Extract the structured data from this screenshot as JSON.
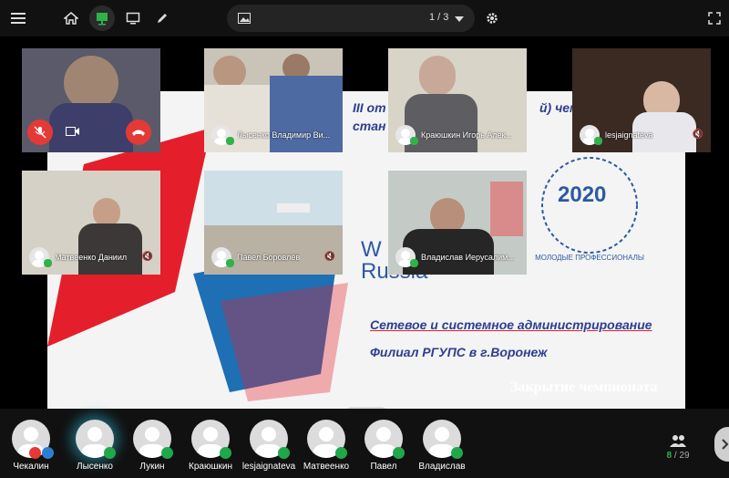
{
  "toolbar": {
    "slide_counter": "1 / 3"
  },
  "slide": {
    "caption": "Закрытие чемпионата",
    "line1": "Сетевое и системное администрирование",
    "line2": "Филиал РГУПС в г.Воронеж",
    "partial_top": "III от",
    "partial_top2": "й) чем",
    "partial_top3": "стан",
    "partial_logo": "W",
    "partial_logo2": "Russia",
    "badge_text": "МОЛОДЫЕ ПРОФЕССИОНАЛЫ",
    "badge_year": "2020"
  },
  "tiles": [
    {
      "name": "",
      "self": true
    },
    {
      "name": "Лысенко Владимир Ви..."
    },
    {
      "name": "Краюшкин Игорь Алек..."
    },
    {
      "name": "lesjaignateva"
    },
    {
      "name": "Матвеенко Даниил"
    },
    {
      "name": "Павел Боровлёв"
    },
    {
      "name": "Владислав Иерусалим..."
    }
  ],
  "participants": {
    "list": [
      "Чекалин",
      "Лысенко",
      "Лукин",
      "Краюшкин",
      "lesjaignateva",
      "Матвеенко",
      "Павел",
      "Владислав"
    ],
    "count_active": "8",
    "count_separator": " / ",
    "count_total": "29"
  },
  "colors": {
    "accent_green": "#2fb24a",
    "end_call_red": "#e53935",
    "slide_blue": "#2c3e91"
  }
}
